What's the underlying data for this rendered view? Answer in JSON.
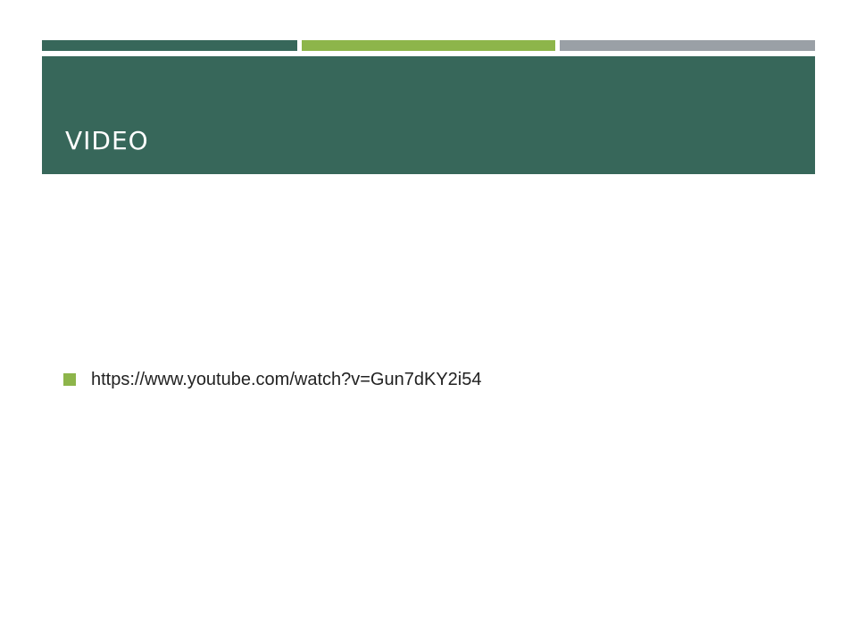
{
  "colors": {
    "primary": "#37675a",
    "accent_green": "#8db54a",
    "accent_gray": "#9aa0a6",
    "title_text": "#ffffff",
    "bullet": "#8db54a"
  },
  "header": {
    "title": "VIDEO"
  },
  "content": {
    "bullets": [
      {
        "text": "https://www.youtube.com/watch?v=Gun7dKY2i54"
      }
    ]
  }
}
